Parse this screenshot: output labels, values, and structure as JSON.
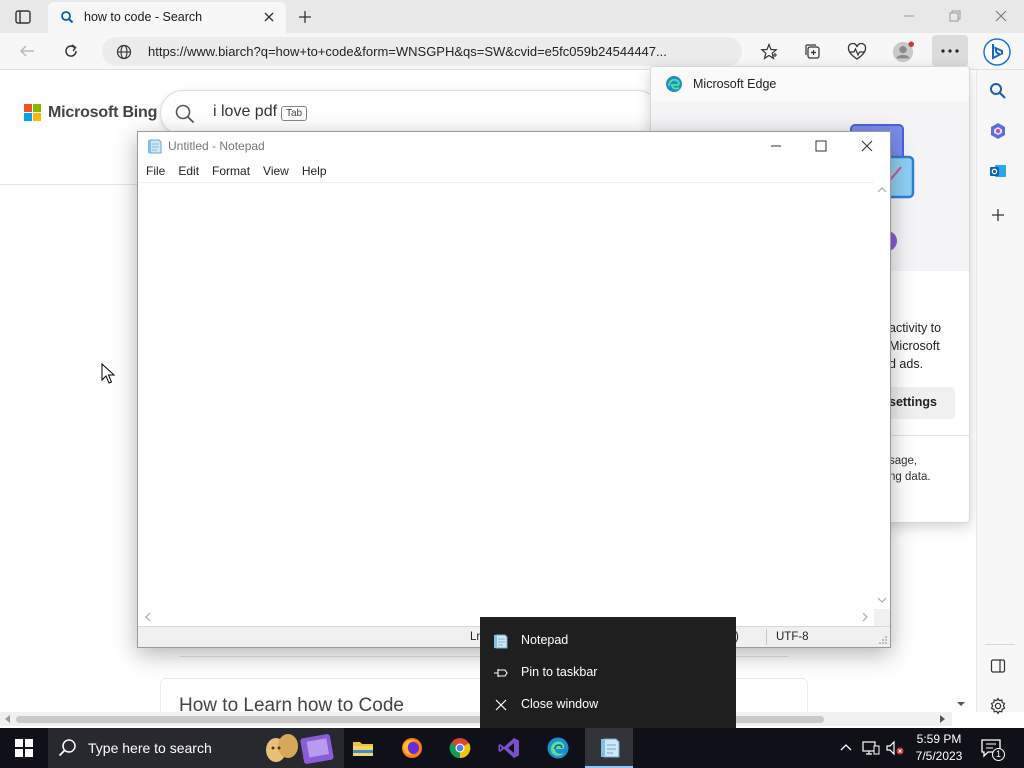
{
  "browser": {
    "tab_title": "how to code - Search",
    "url": "https://www.biarch?q=how+to+code&form=WNSGPH&qs=SW&cvid=e5fc059b24544447..."
  },
  "bing": {
    "logo_text": "Microsoft Bing",
    "search_text": "i love pdf",
    "tab_hint": "Tab",
    "result_title": "How to Learn how to Code"
  },
  "edge_panel": {
    "title": "Microsoft Edge",
    "body_text": "activity to\nMicrosoft\nd ads.",
    "button_label": "settings",
    "small_text": "sage,\nng data."
  },
  "notepad": {
    "title": "Untitled - Notepad",
    "menus": [
      "File",
      "Edit",
      "Format",
      "View",
      "Help"
    ],
    "status_ln": "Ln",
    "status_crlf": "F)",
    "status_encoding": "UTF-8"
  },
  "jumplist": {
    "items": [
      {
        "label": "Notepad",
        "icon": "notepad-icon"
      },
      {
        "label": "Pin to taskbar",
        "icon": "pin-icon"
      },
      {
        "label": "Close window",
        "icon": "close-icon"
      }
    ]
  },
  "taskbar": {
    "search_placeholder": "Type here to search",
    "apps": [
      "file-explorer-icon",
      "firefox-icon",
      "chrome-icon",
      "visual-studio-icon",
      "edge-icon",
      "notepad-icon"
    ],
    "time": "5:59 PM",
    "date": "7/5/2023",
    "notification_count": "1"
  },
  "colors": {
    "accent": "#0078d4",
    "taskbar_bg": "#101018",
    "jumplist_bg": "#1f1f1f"
  }
}
